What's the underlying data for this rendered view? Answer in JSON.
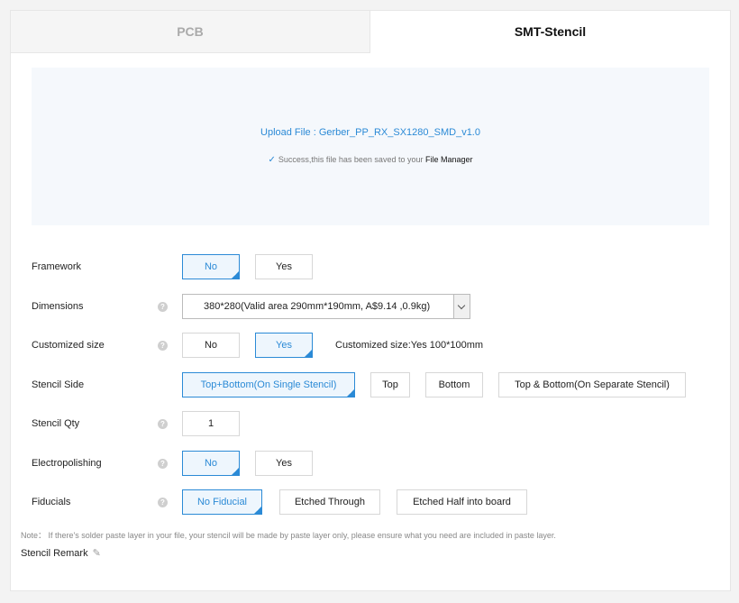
{
  "tabs": {
    "pcb": "PCB",
    "smt": "SMT-Stencil"
  },
  "upload": {
    "title": "Upload File : Gerber_PP_RX_SX1280_SMD_v1.0",
    "check_icon": "✓",
    "status": "Success,this file has been saved to your",
    "file_manager": "File Manager"
  },
  "help_icon": "?",
  "selected_tick": "✓",
  "framework": {
    "label": "Framework",
    "options": [
      "No",
      "Yes"
    ],
    "selected": "No"
  },
  "dimensions": {
    "label": "Dimensions",
    "value": "380*280(Valid area 290mm*190mm, A$9.14 ,0.9kg)"
  },
  "customized_size": {
    "label": "Customized size",
    "options": [
      "No",
      "Yes"
    ],
    "selected": "Yes",
    "summary": "Customized size:Yes 100*100mm"
  },
  "stencil_side": {
    "label": "Stencil Side",
    "options": [
      "Top+Bottom(On Single Stencil)",
      "Top",
      "Bottom",
      "Top & Bottom(On Separate Stencil)"
    ],
    "selected": "Top+Bottom(On Single Stencil)"
  },
  "stencil_qty": {
    "label": "Stencil Qty",
    "value": "1"
  },
  "electropolishing": {
    "label": "Electropolishing",
    "options": [
      "No",
      "Yes"
    ],
    "selected": "No"
  },
  "fiducials": {
    "label": "Fiducials",
    "options": [
      "No Fiducial",
      "Etched Through",
      "Etched Half into board"
    ],
    "selected": "No Fiducial"
  },
  "note": "Note： If there's solder paste layer in your file, your stencil will be made by paste layer only, please ensure what you need are included in paste layer.",
  "remark": {
    "label": "Stencil Remark",
    "edit_icon": "✎"
  },
  "colors": {
    "accent": "#2b8ad6",
    "upload_bg": "#f5f8fc",
    "page_bg": "#f3f3f3"
  }
}
